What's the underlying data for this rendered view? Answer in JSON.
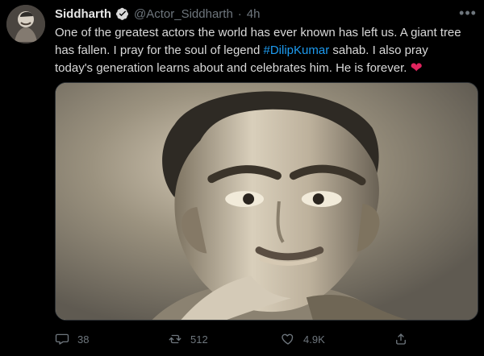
{
  "tweet": {
    "author": {
      "name": "Siddharth",
      "handle": "@Actor_Siddharth",
      "separator": "·",
      "time": "4h"
    },
    "text": {
      "before_hashtag": "One of the greatest actors the world has ever known has left us. A giant tree has fallen. I pray for the soul of legend ",
      "hashtag": "#DilipKumar",
      "after_hashtag": " sahab. I also pray today's generation learns about and celebrates him. He is forever. ",
      "emoji": "❤"
    },
    "actions": {
      "replies": "38",
      "retweets": "512",
      "likes": "4.9K"
    }
  },
  "icons": {
    "verified": "verified-badge-icon",
    "more": "more-options-icon",
    "reply": "reply-icon",
    "retweet": "retweet-icon",
    "like": "heart-icon",
    "share": "share-icon"
  },
  "colors": {
    "background": "#000000",
    "text": "#d9d9d9",
    "muted": "#6e767d",
    "accent": "#1d9bf0",
    "heart": "#e0245e"
  }
}
